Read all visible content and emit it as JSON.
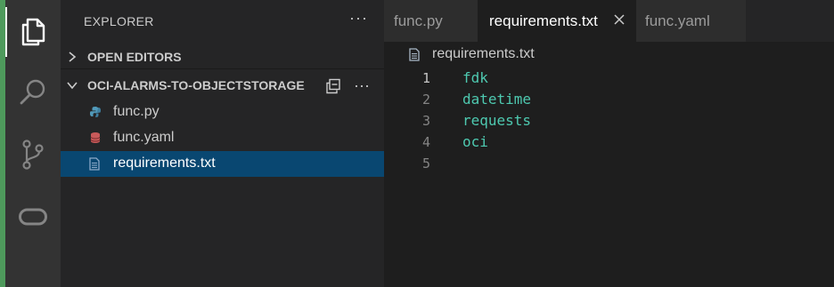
{
  "activity_bar": {
    "items": [
      {
        "icon": "explorer-icon"
      },
      {
        "icon": "search-icon"
      },
      {
        "icon": "source-control-icon"
      },
      {
        "icon": "oci-icon"
      }
    ]
  },
  "sidebar": {
    "title": "EXPLORER",
    "more_actions": "···",
    "open_editors_label": "OPEN EDITORS",
    "folder_label": "OCI-ALARMS-TO-OBJECTSTORAGE",
    "folder_more_actions": "···",
    "files": [
      {
        "name": "func.py",
        "icon": "python-file-icon",
        "color": "#519aba"
      },
      {
        "name": "func.yaml",
        "icon": "yaml-file-icon",
        "color": "#c85a5a"
      },
      {
        "name": "requirements.txt",
        "icon": "text-file-icon",
        "color": "#8aa8c8",
        "selected": true
      }
    ]
  },
  "editor": {
    "tabs": [
      {
        "label": "func.py",
        "active": false
      },
      {
        "label": "requirements.txt",
        "active": true
      },
      {
        "label": "func.yaml",
        "active": false
      }
    ],
    "breadcrumb": "requirements.txt",
    "lines": [
      {
        "num": "1",
        "text": "fdk"
      },
      {
        "num": "2",
        "text": "datetime"
      },
      {
        "num": "3",
        "text": "requests"
      },
      {
        "num": "4",
        "text": "oci"
      },
      {
        "num": "5",
        "text": ""
      }
    ]
  },
  "colors": {
    "accent_left": "#4e9a5c",
    "selection": "#094771",
    "code_text": "#4ec9b0"
  }
}
